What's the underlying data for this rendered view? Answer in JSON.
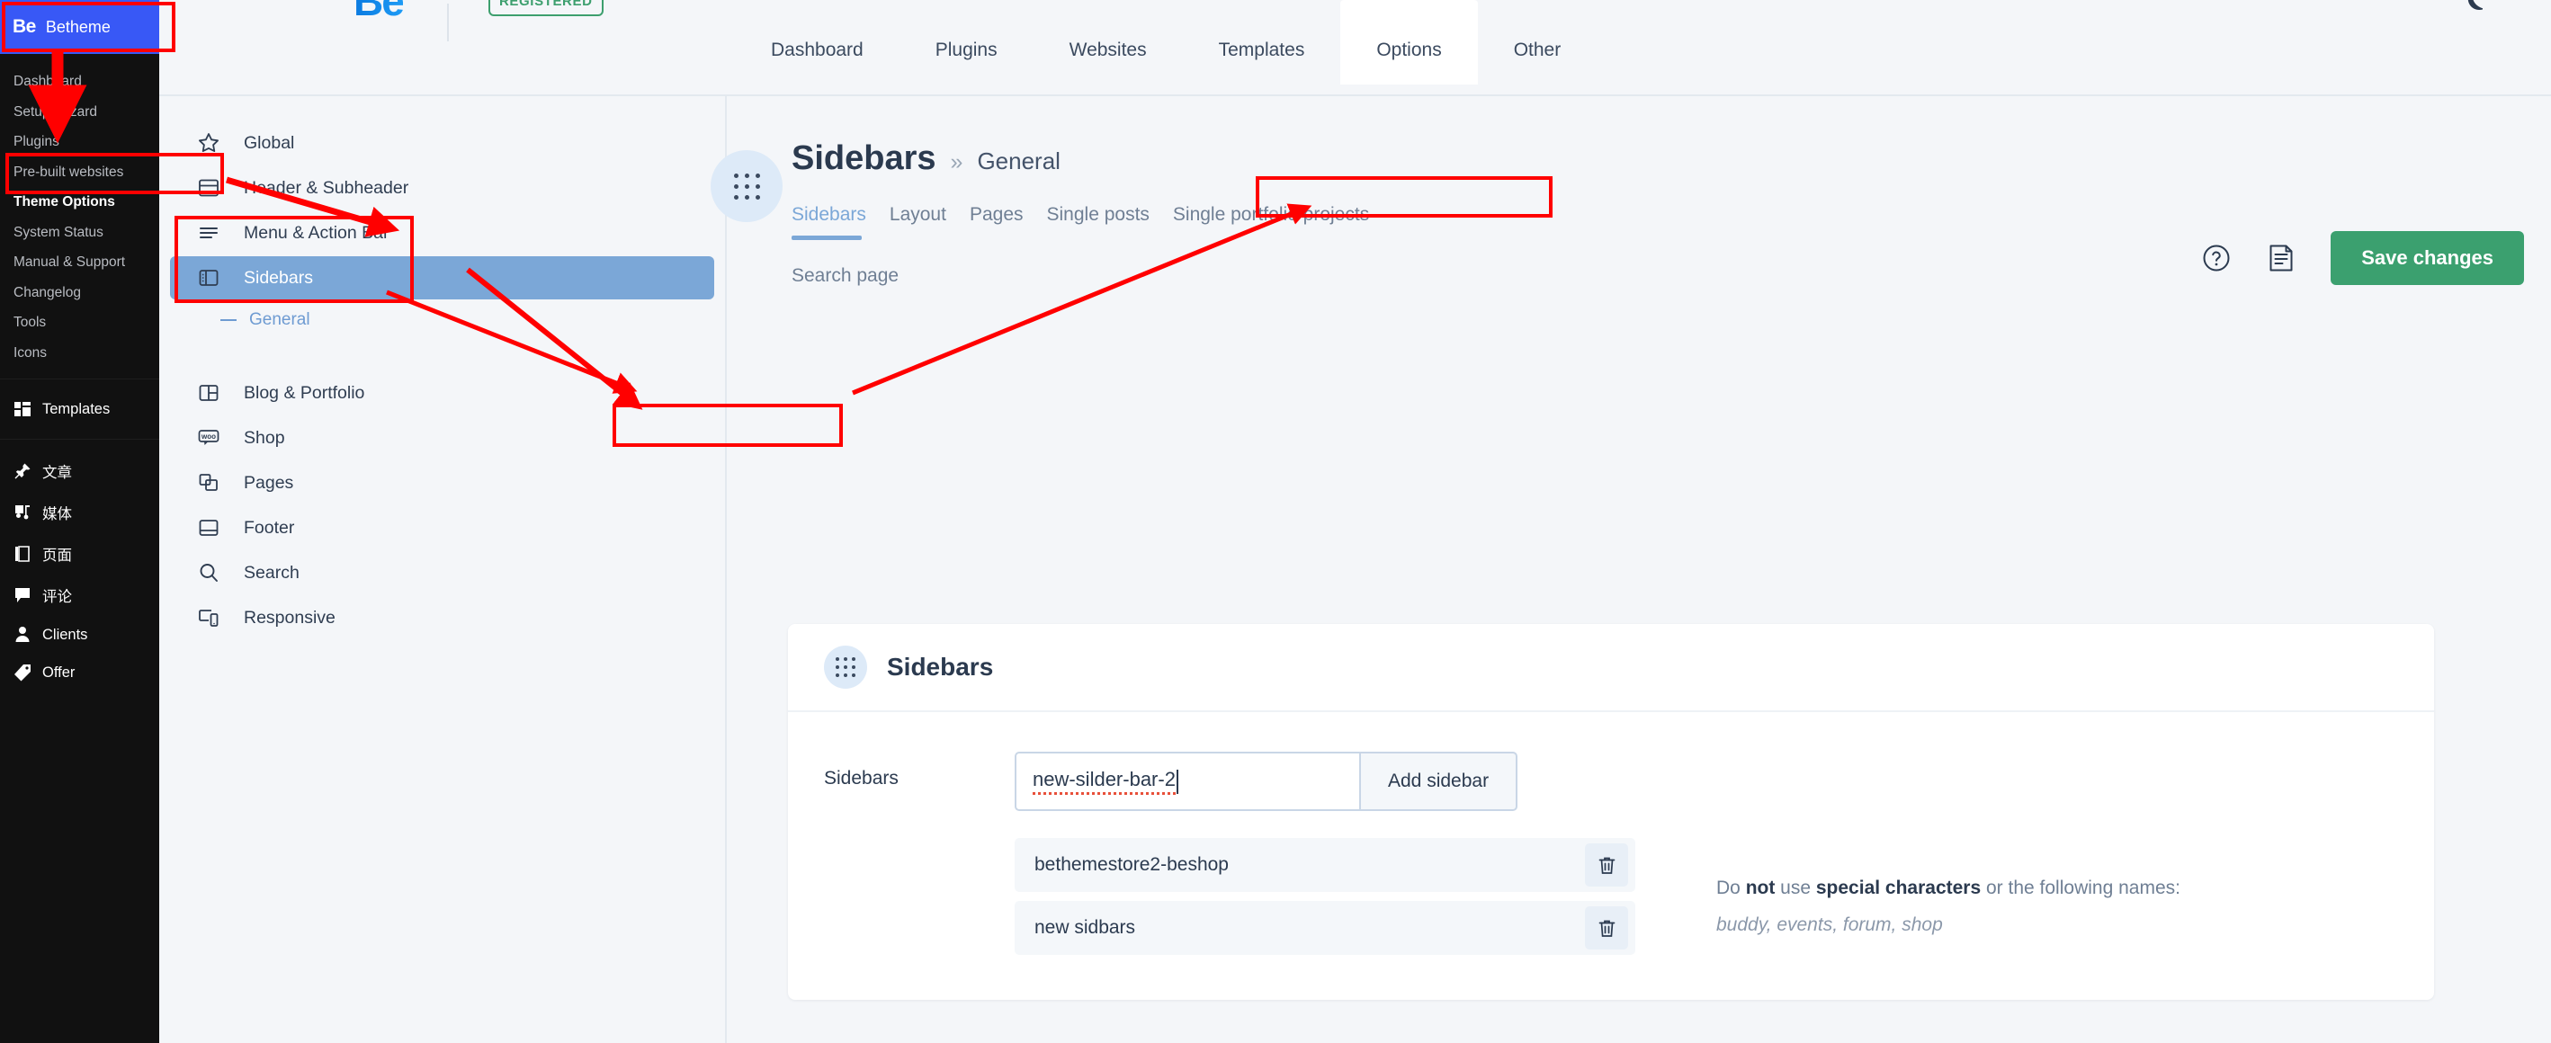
{
  "wp_sidebar": {
    "brand_logo": "Be",
    "brand_name": "Betheme",
    "items": [
      {
        "label": "Dashboard"
      },
      {
        "label": "Setup Wizard"
      },
      {
        "label": "Plugins"
      },
      {
        "label": "Pre-built websites"
      },
      {
        "label": "Theme Options"
      },
      {
        "label": "System Status"
      },
      {
        "label": "Manual & Support"
      },
      {
        "label": "Changelog"
      },
      {
        "label": "Tools"
      },
      {
        "label": "Icons"
      }
    ],
    "icon_items": [
      {
        "label": "Templates",
        "icon": "templates-icon"
      },
      {
        "label": "文章",
        "icon": "pin-icon"
      },
      {
        "label": "媒体",
        "icon": "media-icon"
      },
      {
        "label": "页面",
        "icon": "pages-icon"
      },
      {
        "label": "评论",
        "icon": "comment-icon"
      },
      {
        "label": "Clients",
        "icon": "user-icon"
      },
      {
        "label": "Offer",
        "icon": "tag-icon"
      }
    ],
    "active_item": "Theme Options"
  },
  "topbar": {
    "logo": "Be",
    "badge": "REGISTERED",
    "tabs": [
      {
        "label": "Dashboard",
        "active": false
      },
      {
        "label": "Plugins",
        "active": false
      },
      {
        "label": "Websites",
        "active": false
      },
      {
        "label": "Templates",
        "active": false
      },
      {
        "label": "Options",
        "active": true
      },
      {
        "label": "Other",
        "active": false
      }
    ],
    "moon_icon": "dark-mode-moon-icon"
  },
  "panel2": {
    "items": [
      {
        "label": "Global",
        "icon": "star-icon",
        "selected": false
      },
      {
        "label": "Header & Subheader",
        "icon": "header-icon",
        "selected": false
      },
      {
        "label": "Menu & Action Bar",
        "icon": "menu-lines-icon",
        "selected": false
      },
      {
        "label": "Sidebars",
        "icon": "sidebars-icon",
        "selected": true
      },
      {
        "label": "Blog & Portfolio",
        "icon": "blog-icon",
        "selected": false
      },
      {
        "label": "Shop",
        "icon": "woo-icon",
        "selected": false
      },
      {
        "label": "Pages",
        "icon": "copy-icon",
        "selected": false
      },
      {
        "label": "Footer",
        "icon": "footer-icon",
        "selected": false
      },
      {
        "label": "Search",
        "icon": "search-icon",
        "selected": false
      },
      {
        "label": "Responsive",
        "icon": "responsive-icon",
        "selected": false
      }
    ],
    "sub_item": "General"
  },
  "main": {
    "breadcrumb": {
      "parent": "Sidebars",
      "separator": "»",
      "current": "General"
    },
    "subtabs": [
      {
        "label": "Sidebars",
        "active": true
      },
      {
        "label": "Layout",
        "active": false
      },
      {
        "label": "Pages",
        "active": false
      },
      {
        "label": "Single posts",
        "active": false
      },
      {
        "label": "Single portfolio projects",
        "active": false
      }
    ],
    "subtab_row2": "Search page",
    "help_icon": "question-circle-icon",
    "notes_icon": "notes-document-icon",
    "save_label": "Save changes",
    "card": {
      "title": "Sidebars",
      "drag_icon": "drag-dots-icon",
      "field_label": "Sidebars",
      "input_value": "new-silder-bar-2",
      "input_placeholder": "",
      "add_button": "Add sidebar",
      "sidebars": [
        {
          "name": "bethemestore2-beshop",
          "delete_icon": "trash-icon"
        },
        {
          "name": "new sidbars",
          "delete_icon": "trash-icon"
        }
      ],
      "help_line1_a": "Do ",
      "help_line1_b": "not",
      "help_line1_c": " use ",
      "help_line1_d": "special characters",
      "help_line1_e": " or the following names:",
      "help_line2": "buddy, events, forum, shop"
    }
  },
  "colors": {
    "wp_brand_blue": "#3858f6",
    "wp_dark": "#111111",
    "accent_blue": "#7ba7d7",
    "save_green": "#3ba06f",
    "badge_green": "#3d9f6e",
    "annotation_red": "#ff0000"
  }
}
